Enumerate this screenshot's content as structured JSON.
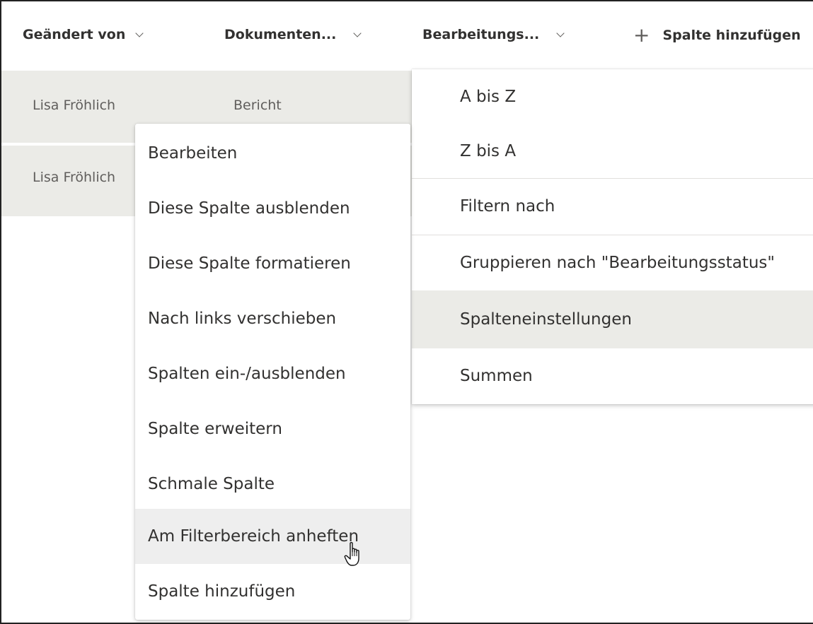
{
  "header": {
    "col1": "Geändert von",
    "col2": "Dokumenten...",
    "col3": "Bearbeitungs...",
    "add_column": "Spalte hinzufügen"
  },
  "rows": [
    {
      "modified_by": "Lisa Fröhlich",
      "doc_type": "Bericht"
    },
    {
      "modified_by": "Lisa Fröhlich",
      "doc_type": ""
    }
  ],
  "context_menu": {
    "items": [
      "Bearbeiten",
      "Diese Spalte ausblenden",
      "Diese Spalte formatieren",
      "Nach links verschieben",
      "Spalten ein-/ausblenden",
      "Spalte erweitern",
      "Schmale Spalte",
      "Am Filterbereich anheften",
      "Spalte hinzufügen"
    ],
    "hovered_item": "Am Filterbereich anheften"
  },
  "column_menu": {
    "items": [
      "A bis Z",
      "Z bis A",
      "Filtern nach",
      "Gruppieren nach \"Bearbeitungsstatus\"",
      "Spalteneinstellungen",
      "Summen"
    ],
    "active_item": "Spalteneinstellungen"
  },
  "icons": {
    "chevron": "chevron-down-icon",
    "add": "plus-icon",
    "pointer": "hand-pointer-cursor-icon"
  },
  "colors": {
    "row_background": "#ebebe7",
    "hover_background": "#eeeeee",
    "text": "#323130",
    "muted_text": "#605e5c"
  }
}
